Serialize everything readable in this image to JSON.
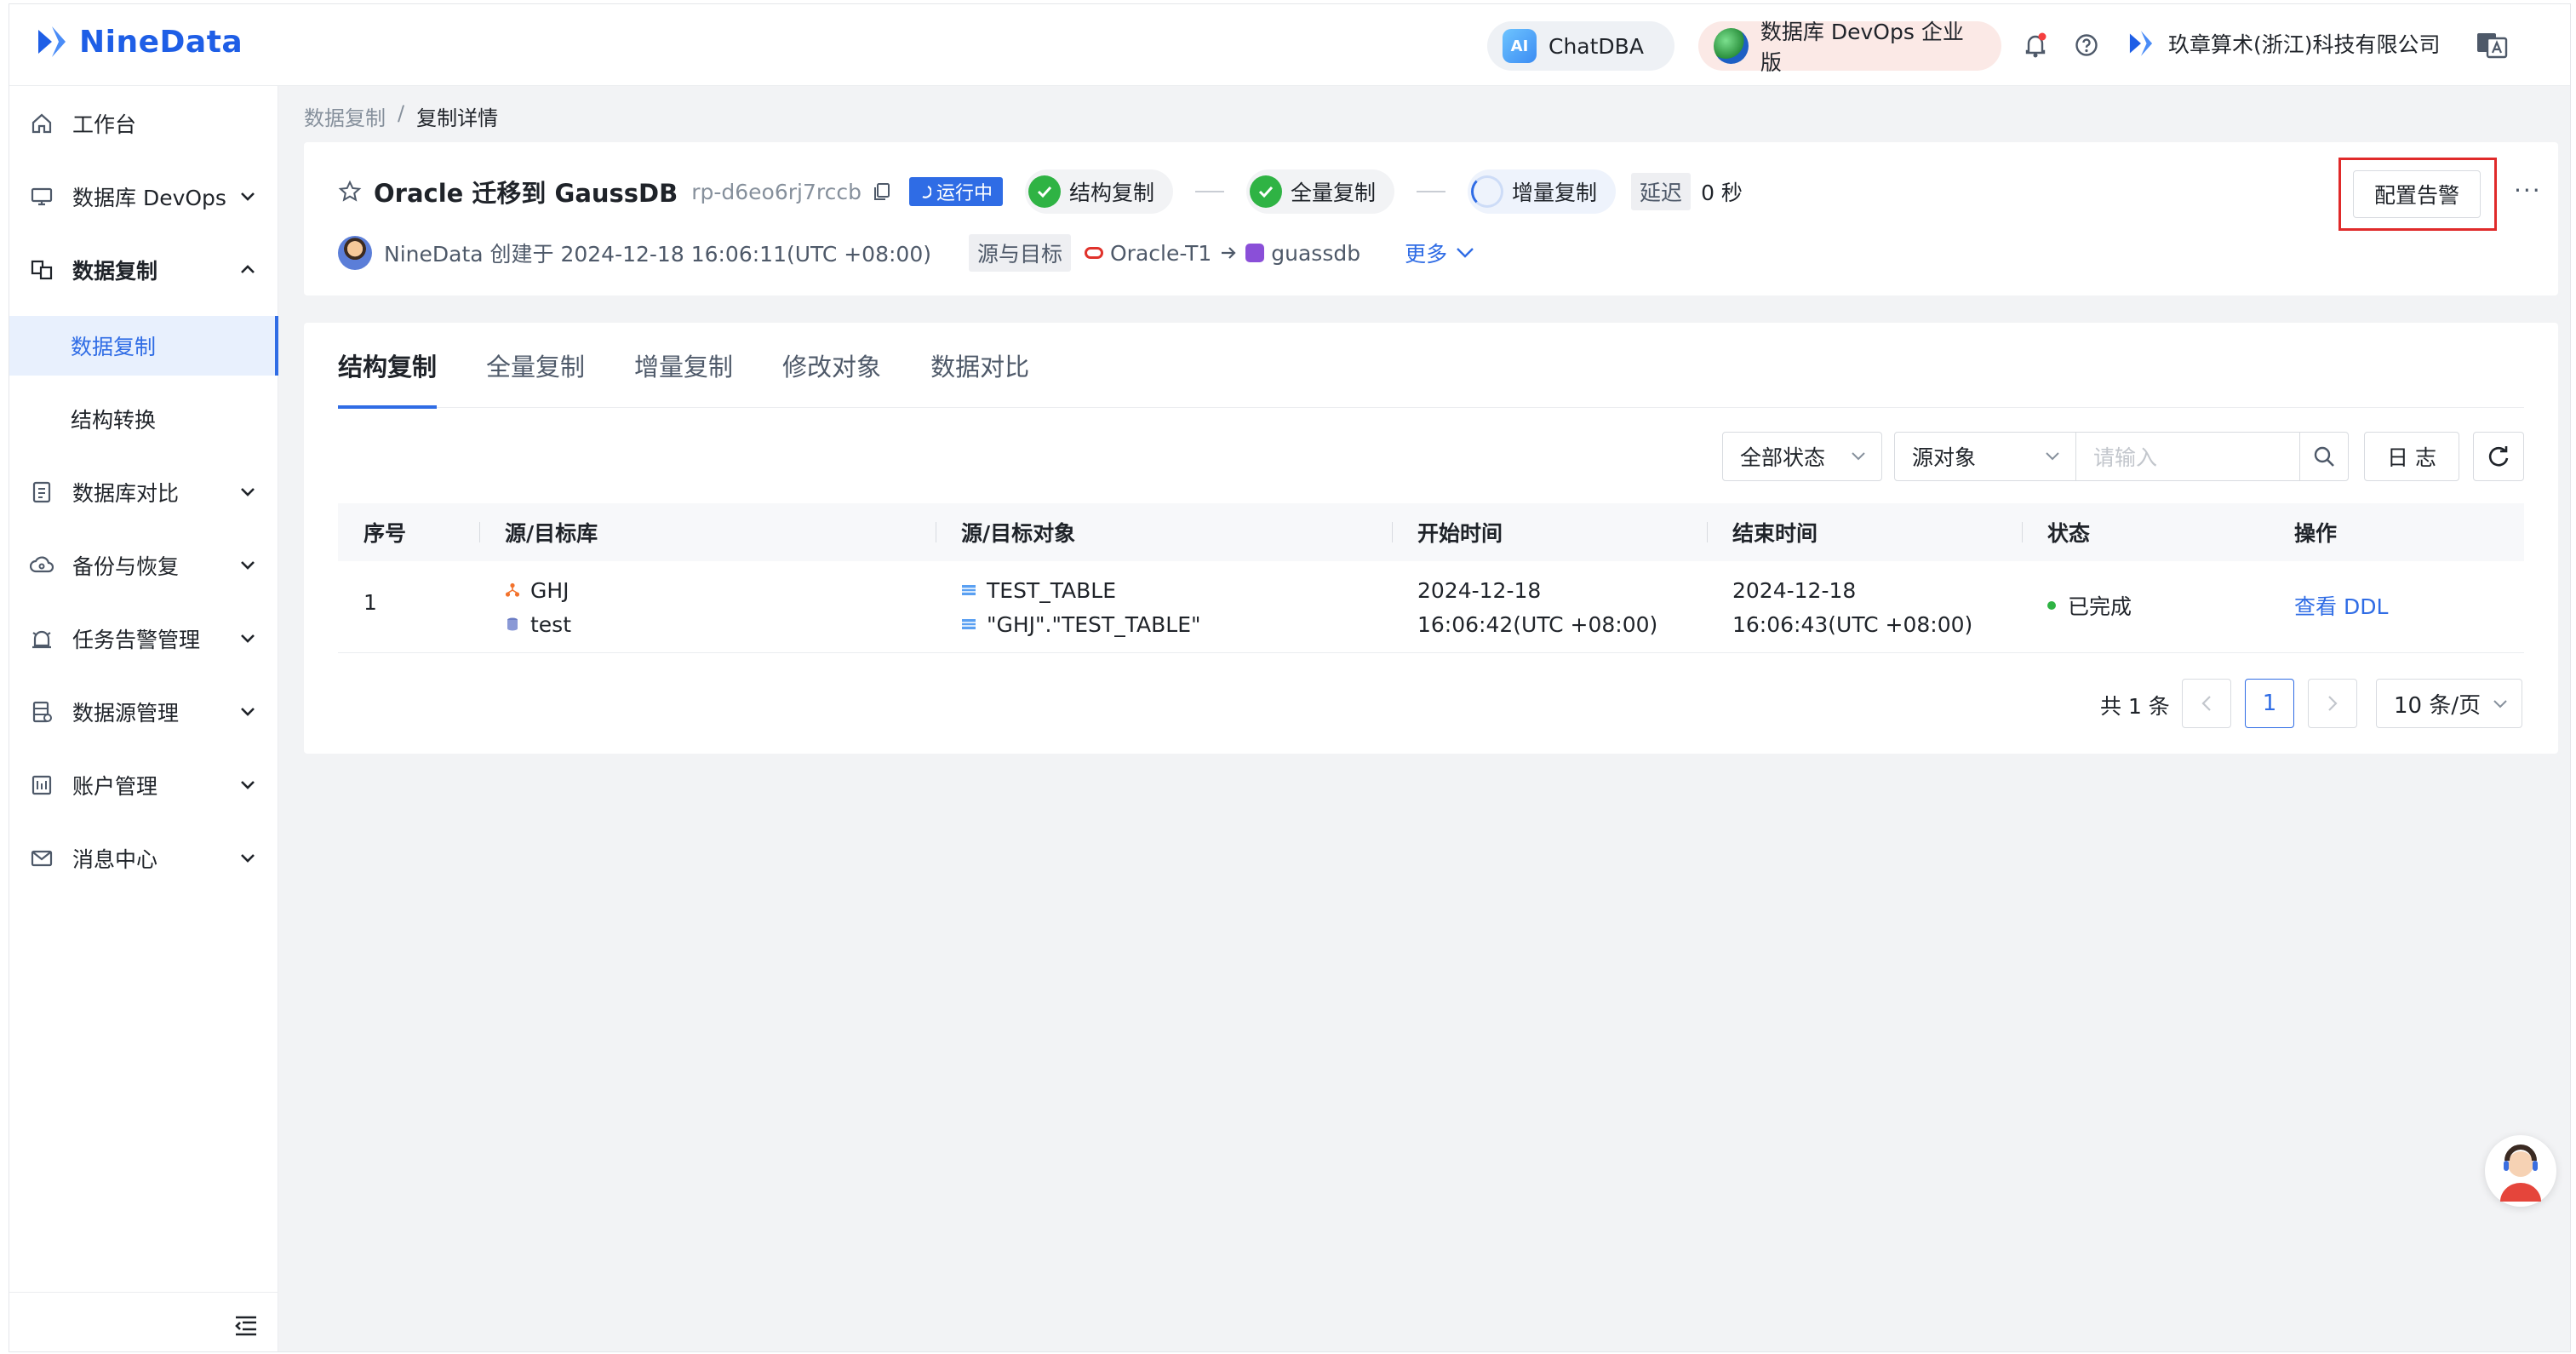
{
  "header": {
    "logo_text": "NineData",
    "chatdba_label": "ChatDBA",
    "ai_badge": "AI",
    "devops_label": "数据库 DevOps 企业版",
    "company": "玖章算术(浙江)科技有限公司",
    "brand_color": "#1e5ee6"
  },
  "sidebar": {
    "items": [
      {
        "label": "工作台"
      },
      {
        "label": "数据库 DevOps"
      },
      {
        "label": "数据复制"
      },
      {
        "label": "数据库对比"
      },
      {
        "label": "备份与恢复"
      },
      {
        "label": "任务告警管理"
      },
      {
        "label": "数据源管理"
      },
      {
        "label": "账户管理"
      },
      {
        "label": "消息中心"
      }
    ],
    "sub_items": [
      {
        "label": "数据复制",
        "active": true
      },
      {
        "label": "结构转换",
        "active": false
      }
    ]
  },
  "breadcrumb": {
    "parent": "数据复制",
    "sep": "/",
    "current": "复制详情"
  },
  "task": {
    "title": "Oracle 迁移到 GaussDB",
    "id": "rp-d6eo6rj7rccb",
    "status": "运行中",
    "steps": [
      {
        "label": "结构复制",
        "state": "done"
      },
      {
        "label": "全量复制",
        "state": "done"
      },
      {
        "label": "增量复制",
        "state": "running"
      }
    ],
    "delay_label": "延迟",
    "delay_value": "0 秒",
    "creator_text": "NineData 创建于 2024-12-18 16:06:11(UTC +08:00)",
    "src_target_label": "源与目标",
    "source": "Oracle-T1",
    "target": "guassdb",
    "more_label": "更多",
    "alert_button": "配置告警",
    "more_menu": "···"
  },
  "tabs": [
    {
      "label": "结构复制",
      "active": true
    },
    {
      "label": "全量复制",
      "active": false
    },
    {
      "label": "增量复制",
      "active": false
    },
    {
      "label": "修改对象",
      "active": false
    },
    {
      "label": "数据对比",
      "active": false
    }
  ],
  "toolbar": {
    "status_filter": "全部状态",
    "object_filter": "源对象",
    "search_placeholder": "请输入",
    "log_button": "日 志"
  },
  "table": {
    "columns": [
      "序号",
      "源/目标库",
      "源/目标对象",
      "开始时间",
      "结束时间",
      "状态",
      "操作"
    ],
    "rows": [
      {
        "index": "1",
        "src_db": "GHJ",
        "dst_db": "test",
        "src_obj": "TEST_TABLE",
        "dst_obj": "\"GHJ\".\"TEST_TABLE\"",
        "start_date": "2024-12-18",
        "start_time": "16:06:42(UTC +08:00)",
        "end_date": "2024-12-18",
        "end_time": "16:06:43(UTC +08:00)",
        "status": "已完成",
        "action": "查看 DDL"
      }
    ]
  },
  "pager": {
    "total": "共 1 条",
    "current_page": "1",
    "page_size": "10 条/页"
  }
}
